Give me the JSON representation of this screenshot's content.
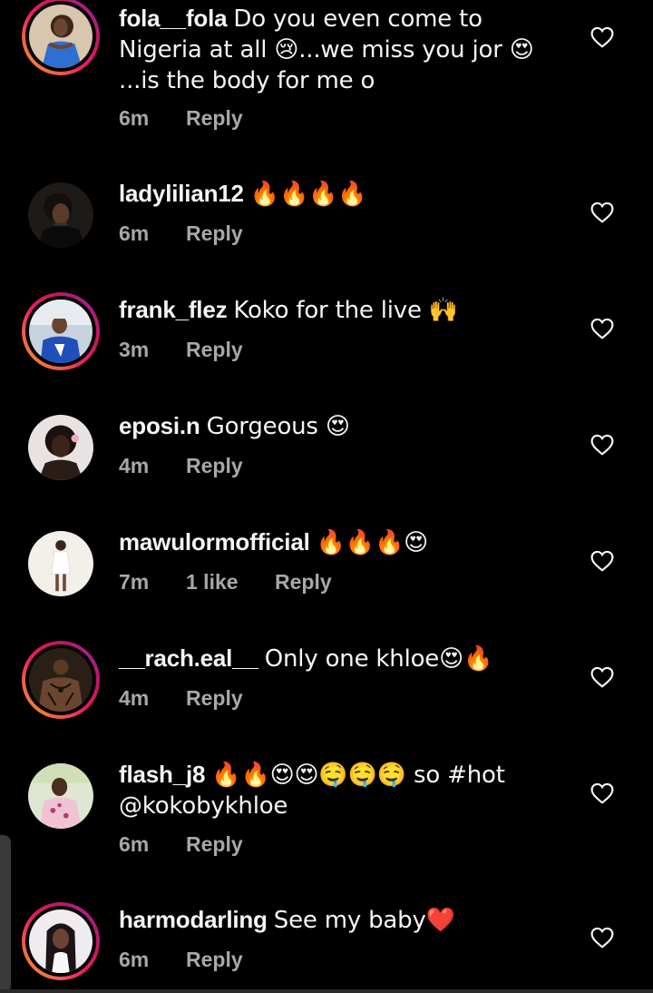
{
  "comments": [
    {
      "username": "fola__fola",
      "text": "Do you even come to Nigeria at all 😢...we miss you jor 😍 ...is the body for me o",
      "time": "6m",
      "likes": "",
      "reply_label": "Reply",
      "avatar_icon": "avatar-photo-woman-blue-top",
      "has_story_ring": true
    },
    {
      "username": "ladylilian12",
      "text": "🔥🔥🔥🔥",
      "time": "6m",
      "likes": "",
      "reply_label": "Reply",
      "avatar_icon": "avatar-photo-woman-dark",
      "has_story_ring": false
    },
    {
      "username": "frank_flez",
      "text": "Koko for the live 🙌",
      "time": "3m",
      "likes": "",
      "reply_label": "Reply",
      "avatar_icon": "avatar-photo-man-blue-outfit",
      "has_story_ring": true
    },
    {
      "username": "eposi.n",
      "text": "Gorgeous 😍",
      "time": "4m",
      "likes": "",
      "reply_label": "Reply",
      "avatar_icon": "avatar-photo-woman-flower",
      "has_story_ring": false
    },
    {
      "username": "mawulormofficial",
      "text": "🔥🔥🔥😍",
      "time": "7m",
      "likes": "1 like",
      "reply_label": "Reply",
      "avatar_icon": "avatar-photo-woman-white-dress",
      "has_story_ring": false
    },
    {
      "username": "__rach.eal__",
      "text": "Only one khloe😍🔥",
      "time": "4m",
      "likes": "",
      "reply_label": "Reply",
      "avatar_icon": "avatar-photo-man-tattoos",
      "has_story_ring": true
    },
    {
      "username": "flash_j8",
      "text": "🔥🔥😍😍🤤🤤🤤 so #hot @kokobykhloe",
      "time": "6m",
      "likes": "",
      "reply_label": "Reply",
      "avatar_icon": "avatar-photo-man-pink-shirt",
      "has_story_ring": false
    },
    {
      "username": "harmodarling",
      "text": "See my baby❤️",
      "time": "6m",
      "likes": "",
      "reply_label": "Reply",
      "avatar_icon": "avatar-photo-woman-long-hair",
      "has_story_ring": true
    }
  ],
  "colors": {
    "background": "#000000",
    "text": "#f5f5f5",
    "meta": "#a8a8a8",
    "ring_start": "#f9a825",
    "ring_end": "#c2185b"
  },
  "icons": {
    "like": "heart-outline-icon"
  }
}
